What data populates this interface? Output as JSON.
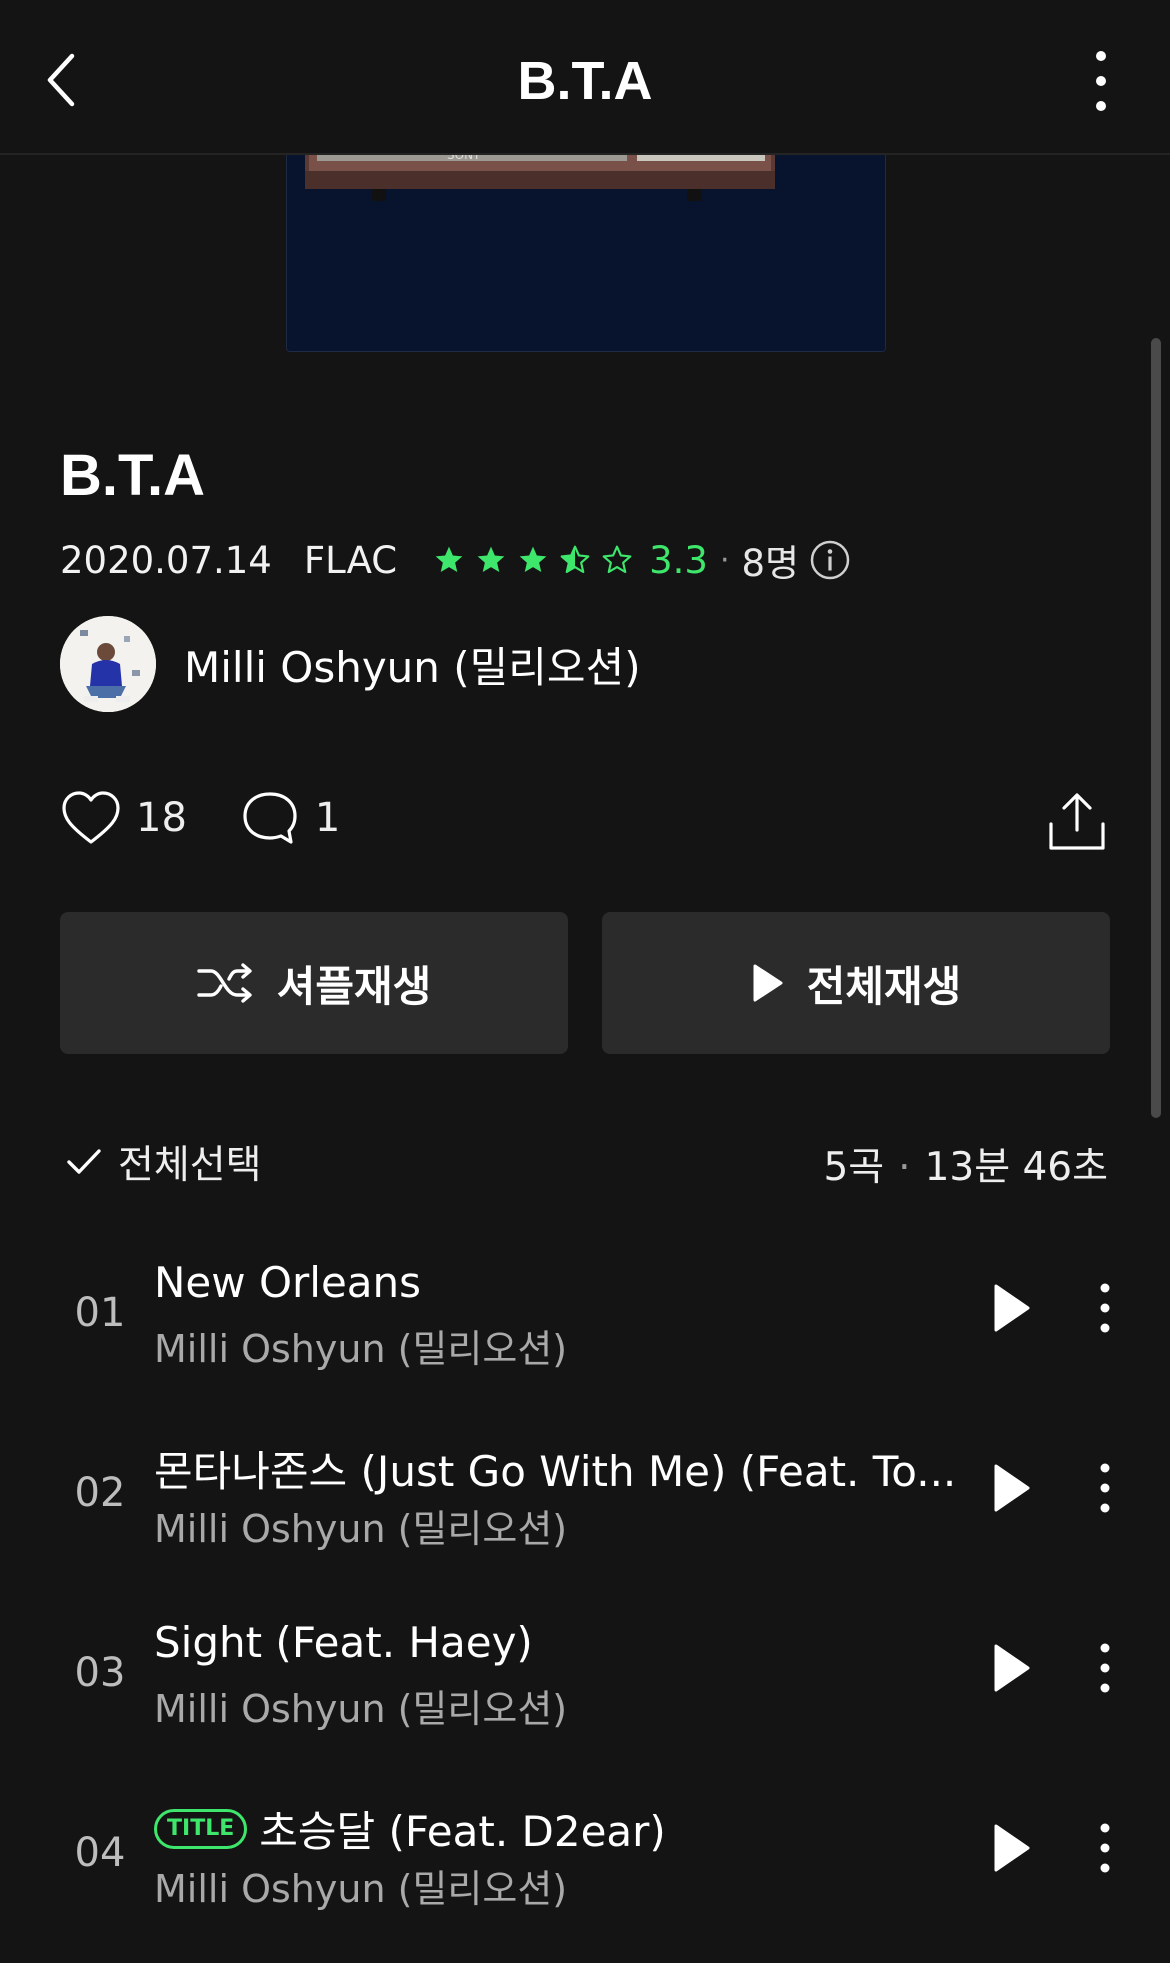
{
  "header": {
    "title": "B.T.A"
  },
  "album": {
    "title": "B.T.A",
    "date": "2020.07.14",
    "format": "FLAC",
    "rating": 3.3,
    "rating_text": "3.3",
    "dot": "·",
    "raters": "8명",
    "artist": "Milli Oshyun (밀리오션)"
  },
  "cover": {
    "tv_brand": "SONY"
  },
  "social": {
    "likes": "18",
    "comments": "1"
  },
  "buttons": {
    "shuffle": "셔플재생",
    "play_all": "전체재생"
  },
  "list_header": {
    "select_all": "전체선택",
    "song_count": "5곡",
    "dot": "·",
    "duration": "13분 46초"
  },
  "tracks": [
    {
      "num": "01",
      "title": "New Orleans",
      "artist": "Milli Oshyun (밀리오션)",
      "badge": ""
    },
    {
      "num": "02",
      "title": "몬타나존스 (Just Go With Me) (Feat. To...",
      "artist": "Milli Oshyun (밀리오션)",
      "badge": ""
    },
    {
      "num": "03",
      "title": "Sight (Feat. Haey)",
      "artist": "Milli Oshyun (밀리오션)",
      "badge": ""
    },
    {
      "num": "04",
      "title": "초승달 (Feat. D2ear)",
      "artist": "Milli Oshyun (밀리오션)",
      "badge": "TITLE"
    }
  ],
  "colors": {
    "accent": "#3ee66b",
    "background": "#141414",
    "button": "#2b2b2b"
  }
}
